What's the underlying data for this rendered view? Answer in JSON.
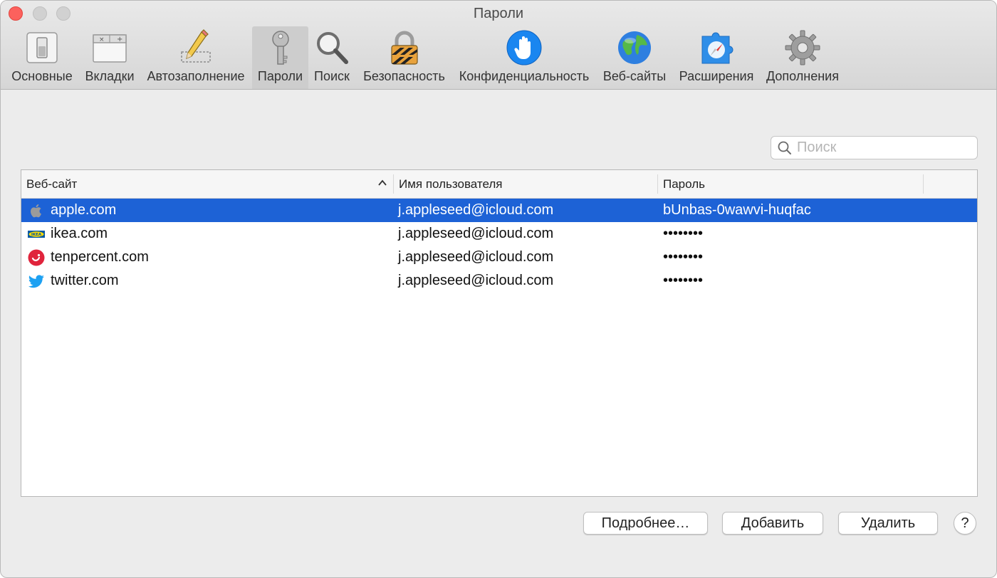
{
  "window": {
    "title": "Пароли"
  },
  "toolbar": {
    "items": [
      {
        "label": "Основные",
        "icon": "general-switch-icon"
      },
      {
        "label": "Вкладки",
        "icon": "tabs-icon"
      },
      {
        "label": "Автозаполнение",
        "icon": "autofill-pencil-icon"
      },
      {
        "label": "Пароли",
        "icon": "key-icon",
        "active": true
      },
      {
        "label": "Поиск",
        "icon": "magnifier-icon"
      },
      {
        "label": "Безопасность",
        "icon": "padlock-icon"
      },
      {
        "label": "Конфиденциальность",
        "icon": "privacy-hand-icon"
      },
      {
        "label": "Веб-сайты",
        "icon": "globe-icon"
      },
      {
        "label": "Расширения",
        "icon": "extensions-puzzle-icon"
      },
      {
        "label": "Дополнения",
        "icon": "gear-icon"
      }
    ]
  },
  "search": {
    "placeholder": "Поиск",
    "value": ""
  },
  "table": {
    "columns": [
      "Веб-сайт",
      "Имя пользователя",
      "Пароль"
    ],
    "sort_column": "Веб-сайт",
    "sort_direction": "ascending",
    "rows": [
      {
        "site": "apple.com",
        "favicon": "apple-logo-icon",
        "username": "j.appleseed@icloud.com",
        "password": "bUnbas-0wawvi-huqfac",
        "selected": true
      },
      {
        "site": "ikea.com",
        "favicon": "ikea-logo-icon",
        "username": "j.appleseed@icloud.com",
        "password": "••••••••"
      },
      {
        "site": "tenpercent.com",
        "favicon": "tenpercent-logo-icon",
        "username": "j.appleseed@icloud.com",
        "password": "••••••••"
      },
      {
        "site": "twitter.com",
        "favicon": "twitter-bird-icon",
        "username": "j.appleseed@icloud.com",
        "password": "••••••••"
      }
    ]
  },
  "buttons": {
    "details": "Подробнее…",
    "add": "Добавить",
    "remove": "Удалить",
    "help": "?"
  },
  "colors": {
    "selection": "#1d62d6",
    "close_button": "#fc615d",
    "twitter": "#1da1f2",
    "tenpercent": "#e0243c"
  }
}
